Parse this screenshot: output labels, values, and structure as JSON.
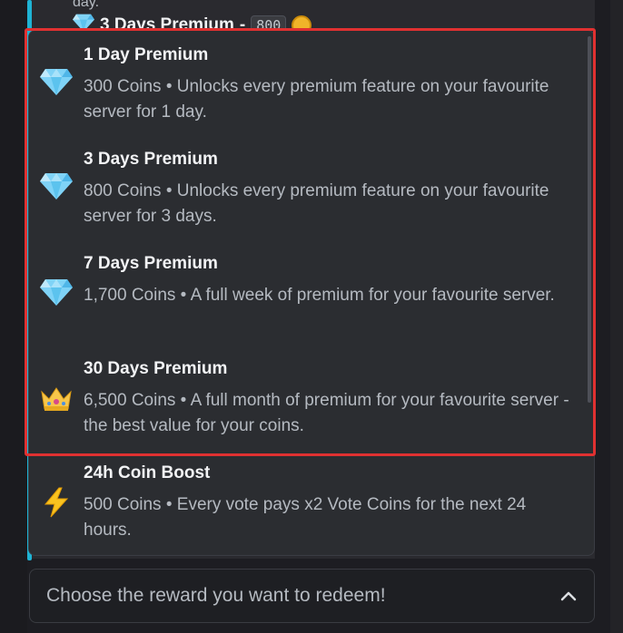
{
  "background_message": {
    "previous_line": "day.",
    "title": "3 Days Premium",
    "separator": "-",
    "code": "800",
    "icon": "gem-icon",
    "coin_icon": "coin-icon"
  },
  "dropdown": {
    "options": [
      {
        "icon": "gem-icon",
        "title": "1 Day Premium",
        "description": "300 Coins • Unlocks every premium feature on your favourite server for 1 day."
      },
      {
        "icon": "gem-icon",
        "title": "3 Days Premium",
        "description": "800 Coins • Unlocks every premium feature on your favourite server for 3 days."
      },
      {
        "icon": "gem-icon",
        "title": "7 Days Premium",
        "description": "1,700 Coins • A full week of premium for your favourite server."
      },
      {
        "icon": "crown-icon",
        "title": "30 Days Premium",
        "description": "6,500 Coins • A full month of premium for your favourite server - the best value for your coins."
      },
      {
        "icon": "lightning-icon",
        "title": "24h Coin Boost",
        "description": "500 Coins • Every vote pays x2 Vote Coins for the next 24 hours."
      }
    ]
  },
  "select": {
    "placeholder": "Choose the reward you want to redeem!",
    "state": "open"
  },
  "colors": {
    "accent_bar": "#1fb3d4",
    "highlight": "#e03131",
    "panel": "#2b2d31"
  }
}
